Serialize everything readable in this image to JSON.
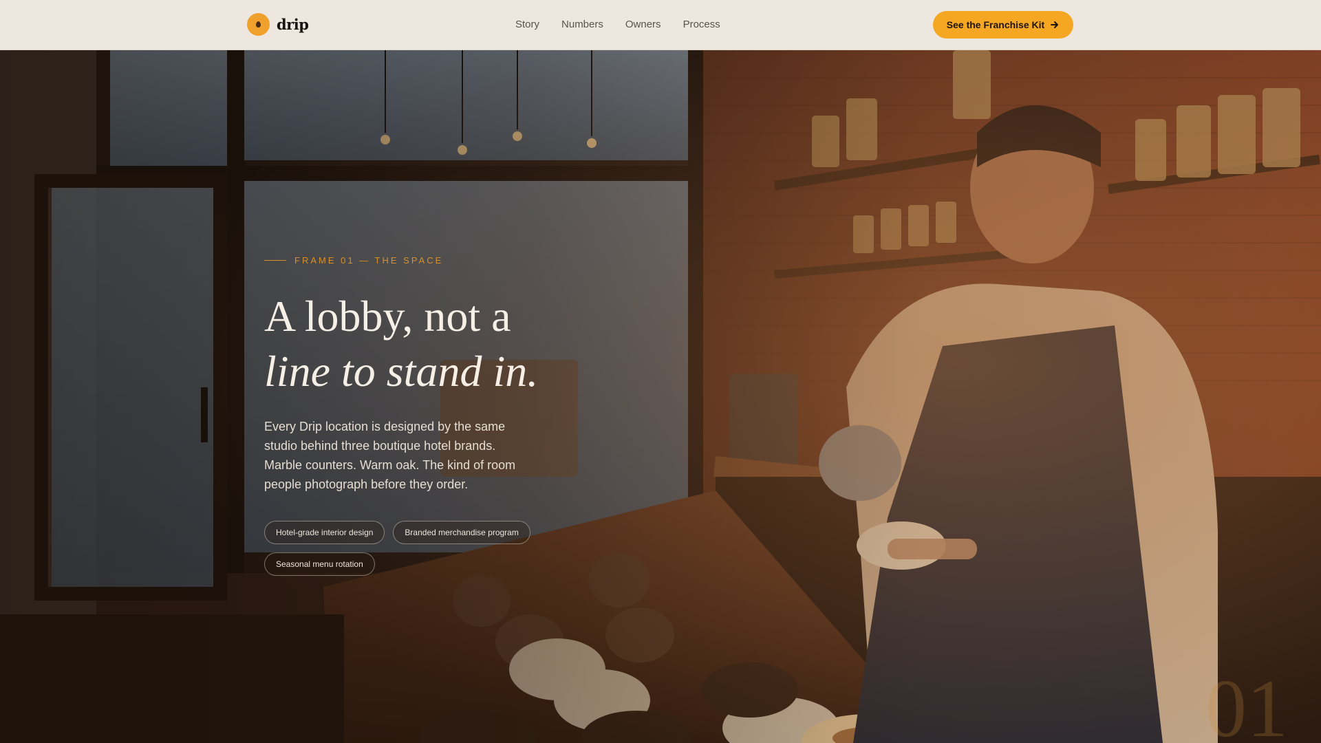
{
  "nav": {
    "brand": "drip",
    "links": [
      "Story",
      "Numbers",
      "Owners",
      "Process"
    ],
    "cta_label": "See the Franchise Kit",
    "cta_icon": "arrow-right-icon"
  },
  "hero": {
    "eyebrow": "FRAME 01 — THE SPACE",
    "headline_line1": "A lobby, not a",
    "headline_line2": "line to stand in.",
    "lede": "Every Drip location is designed by the same studio behind three boutique hotel brands. Marble counters. Warm oak. The kind of room people photograph before they order.",
    "tags": [
      "Hotel-grade interior design",
      "Branded merchandise program",
      "Seasonal menu rotation"
    ],
    "frame_number": "01"
  },
  "colors": {
    "accent": "#f5a623",
    "eyebrow": "#d8902c",
    "nav_bg": "#ede7df"
  }
}
